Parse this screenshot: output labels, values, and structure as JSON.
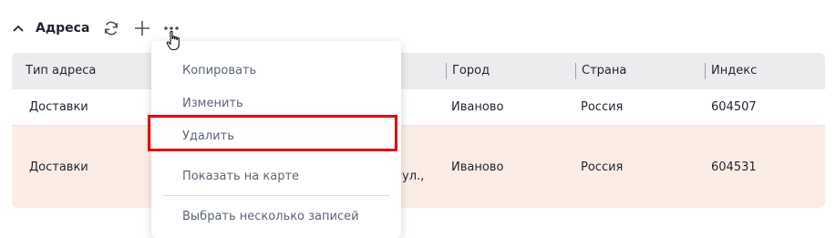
{
  "section": {
    "title": "Адреса",
    "icons": {
      "collapse": "chevron-up-icon",
      "refresh": "refresh-icon",
      "add": "plus-icon",
      "more": "more-horizontal-icon"
    }
  },
  "table": {
    "headers": {
      "address_type": "Тип адреса",
      "city": "Город",
      "country": "Страна",
      "index": "Индекс"
    },
    "rows": [
      {
        "address_type": "Доставки",
        "address_tail": "",
        "city": "Иваново",
        "country": "Россия",
        "index": "604507"
      },
      {
        "address_type": "Доставки",
        "address_tail": "ул.,",
        "city": "Иваново",
        "country": "Россия",
        "index": "604531"
      }
    ]
  },
  "context_menu": {
    "items": [
      "Копировать",
      "Изменить",
      "Удалить",
      "Показать на карте",
      "Выбрать несколько записей"
    ],
    "highlighted_item": "Удалить"
  },
  "colors": {
    "highlight_border": "#e3000f",
    "selected_row_bg": "#fcece6",
    "header_bg": "#ececee"
  }
}
